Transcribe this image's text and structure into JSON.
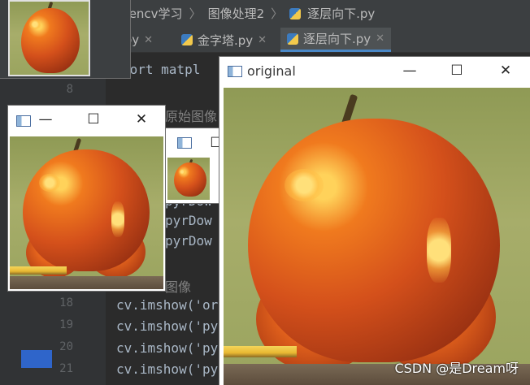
{
  "ide": {
    "breadcrumb": [
      "opencv学习",
      "图像处理2",
      "逐层向下.py"
    ],
    "tabs": [
      {
        "label": ".py"
      },
      {
        "label": "金字塔.py"
      },
      {
        "label": "逐层向下.py"
      }
    ],
    "code_top": "port matpl",
    "comment_1": "原始图像",
    "pyrdown_lines": [
      "pyrDow",
      "pyrDow",
      "pyrDow"
    ],
    "comment_2": "图像",
    "imshow_lines": [
      {
        "num": "18",
        "code": "cv.imshow('or"
      },
      {
        "num": "19",
        "code": "cv.imshow('py"
      },
      {
        "num": "20",
        "code": "cv.imshow('py"
      },
      {
        "num": "21",
        "code": "cv.imshow('py"
      }
    ],
    "line_8": "8"
  },
  "windows": {
    "original": {
      "title": "original"
    },
    "medium": {},
    "tiny": {},
    "topleft": {}
  },
  "titlebar_glyphs": {
    "minimize": "—",
    "maximize": "☐",
    "close": "✕"
  },
  "icons": [
    "window-app-icon",
    "python-file-icon",
    "close-icon",
    "minimize-icon",
    "maximize-icon"
  ],
  "watermark": "CSDN @是Dream呀",
  "colors": {
    "ide_bg": "#2b2b2b",
    "panel": "#3c3f41",
    "selection": "#2f65ca",
    "apple": "#d4501b"
  }
}
